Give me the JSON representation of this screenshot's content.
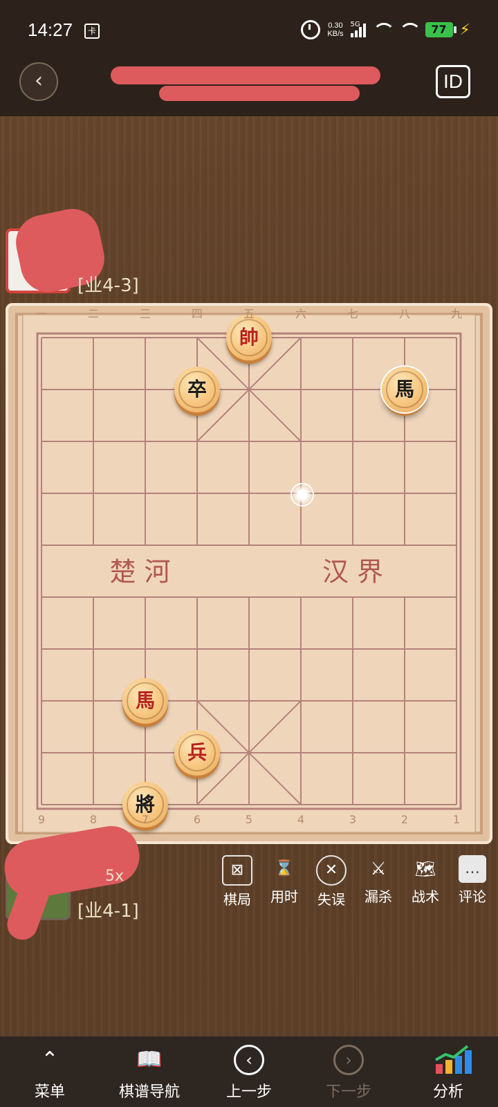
{
  "status_bar": {
    "time": "14:27",
    "sim_icon": "sim-card-icon",
    "net_speed_value": "0.30",
    "net_speed_unit": "KB/s",
    "signal_label": "5G",
    "battery": "77"
  },
  "header": {
    "back_icon": "back-arrow-icon",
    "title": "",
    "id_label": "ID"
  },
  "players": {
    "top": {
      "rank": "[业4-3]"
    },
    "bottom": {
      "rank": "[业4-1]",
      "suffix": "5x"
    }
  },
  "board": {
    "top_coords": [
      "一",
      "二",
      "三",
      "四",
      "五",
      "六",
      "七",
      "八",
      "九"
    ],
    "bottom_coords": [
      "9",
      "8",
      "7",
      "6",
      "5",
      "4",
      "3",
      "2",
      "1"
    ],
    "river_left": "楚 河",
    "river_right": "汉 界",
    "pieces": [
      {
        "char": "帥",
        "color": "red",
        "col": 5,
        "row": 0
      },
      {
        "char": "卒",
        "color": "black",
        "col": 4,
        "row": 1
      },
      {
        "char": "馬",
        "color": "black",
        "col": 8,
        "row": 1,
        "selected": true
      },
      {
        "char": "馬",
        "color": "red",
        "col": 3,
        "row": 7
      },
      {
        "char": "兵",
        "color": "red",
        "col": 4,
        "row": 8
      },
      {
        "char": "將",
        "color": "black",
        "col": 3,
        "row": 9
      }
    ],
    "target": {
      "col": 6,
      "row": 3
    }
  },
  "tools": [
    {
      "label": "棋局",
      "icon": "board-icon"
    },
    {
      "label": "用时",
      "icon": "hourglass-icon"
    },
    {
      "label": "失误",
      "icon": "x-circle-icon"
    },
    {
      "label": "漏杀",
      "icon": "swords-icon"
    },
    {
      "label": "战术",
      "icon": "map-icon"
    },
    {
      "label": "评论",
      "icon": "comment-icon"
    }
  ],
  "bottom_nav": [
    {
      "label": "菜单",
      "icon": "menu-icon"
    },
    {
      "label": "棋谱导航",
      "icon": "book-icon"
    },
    {
      "label": "上一步",
      "icon": "prev-icon"
    },
    {
      "label": "下一步",
      "icon": "next-icon",
      "disabled": true
    },
    {
      "label": "分析",
      "icon": "analysis-chart-icon"
    }
  ]
}
